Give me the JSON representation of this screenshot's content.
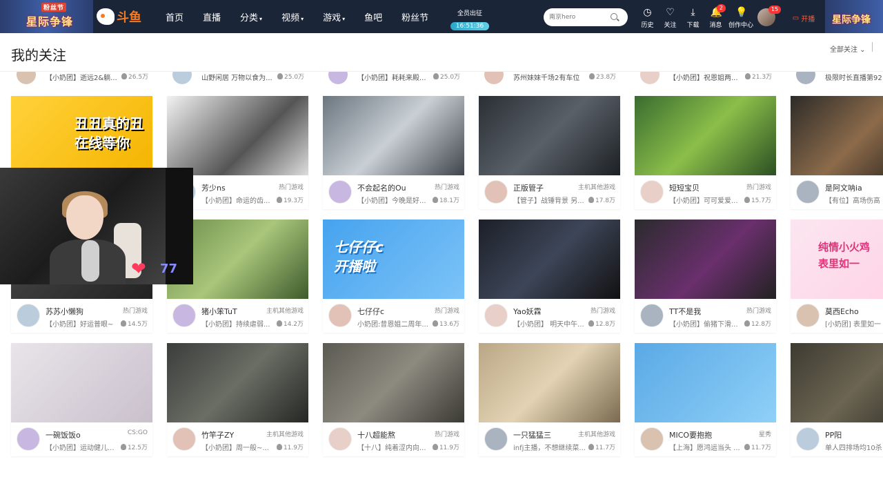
{
  "nav": {
    "banner_left": "星际争锋",
    "banner_left_small": "粉丝节",
    "logo_text": "斗鱼",
    "items": [
      {
        "label": "首页",
        "caret": ""
      },
      {
        "label": "直播",
        "caret": ""
      },
      {
        "label": "分类",
        "caret": "▾"
      },
      {
        "label": "视频",
        "caret": "▾"
      },
      {
        "label": "游戏",
        "caret": "▾"
      },
      {
        "label": "鱼吧",
        "caret": ""
      },
      {
        "label": "粉丝节",
        "caret": ""
      }
    ],
    "event_title": "全员出征",
    "event_timer": "16:51:36",
    "search_placeholder": "南京hero",
    "tools": [
      {
        "label": "历史",
        "icon": "◷",
        "badge": ""
      },
      {
        "label": "关注",
        "icon": "♡",
        "badge": ""
      },
      {
        "label": "下载",
        "icon": "⤓",
        "badge": ""
      },
      {
        "label": "消息",
        "icon": "🔔",
        "badge": "2"
      },
      {
        "label": "创作中心",
        "icon": "💡",
        "badge": ""
      }
    ],
    "avatar_badge": "15",
    "live_button": "开播",
    "banner_right": "星际争锋"
  },
  "page": {
    "title": "我的关注",
    "filter_label": "全部关注 ⌄"
  },
  "partial_row": [
    {
      "desc": "【小奶团】逝远2&躺...",
      "hot": "26.5万"
    },
    {
      "desc": "山野闲居 万物以食为...",
      "hot": "25.0万"
    },
    {
      "desc": "【小奶团】耗耗来殿...",
      "hot": "25.0万"
    },
    {
      "desc": "苏州妹妹千场2有车位",
      "hot": "23.8万"
    },
    {
      "desc": "【小奶团】祝恩姐两...",
      "hot": "21.3万"
    },
    {
      "desc": "极限时长直播第92"
    }
  ],
  "cards": [
    {
      "name": "",
      "category": "",
      "desc": "",
      "hot": "",
      "overlay": "丑丑真的丑\n在线等你"
    },
    {
      "name": "芳少ns",
      "category": "热门游戏",
      "desc": "【小奶团】命运的齿...",
      "hot": "19.3万",
      "overlay": ""
    },
    {
      "name": "不会起名的Ou",
      "category": "热门游戏",
      "desc": "【小奶团】今晚是好...",
      "hot": "18.1万",
      "overlay": ""
    },
    {
      "name": "正版管子",
      "category": "主机其他游戏",
      "desc": "【管子】战锤背景 另...",
      "hot": "17.8万",
      "overlay": ""
    },
    {
      "name": "短短宝贝",
      "category": "热门游戏",
      "desc": "【小奶团】可可爱爱...",
      "hot": "15.7万",
      "overlay": ""
    },
    {
      "name": "是阿文呐ia",
      "category": "",
      "desc": "【有位】高场伤高",
      "hot": "",
      "overlay": ""
    },
    {
      "name": "苏苏小懒狗",
      "category": "热门游戏",
      "desc": "【小奶团】好运普眼~",
      "hot": "14.5万",
      "overlay": ""
    },
    {
      "name": "猪小笨TuT",
      "category": "主机其他游戏",
      "desc": "【小奶团】持续虐弱...",
      "hot": "14.2万",
      "overlay": ""
    },
    {
      "name": "七仔仔c",
      "category": "热门游戏",
      "desc": "小奶团:昔恩姐二周年...",
      "hot": "13.6万",
      "overlay": "七仔仔c\n开播啦"
    },
    {
      "name": "Yao妖霖",
      "category": "热门游戏",
      "desc": "【小奶团】 明天中午...",
      "hot": "12.8万",
      "overlay": ""
    },
    {
      "name": "TT不是我",
      "category": "热门游戏",
      "desc": "【小奶团】偷猪下滑...",
      "hot": "12.8万",
      "overlay": ""
    },
    {
      "name": "莫西Echo",
      "category": "",
      "desc": "[小奶团] 表里如一",
      "hot": "",
      "overlay": "纯情小火鸡\n表里如一"
    },
    {
      "name": "一碗饭饭o",
      "category": "CS:GO",
      "desc": "【小奶团】运动健儿...",
      "hot": "12.5万",
      "overlay": ""
    },
    {
      "name": "竹竿子ZY",
      "category": "主机其他游戏",
      "desc": "【小奶团】周一般~...",
      "hot": "11.9万",
      "overlay": ""
    },
    {
      "name": "十八超能熬",
      "category": "热门游戏",
      "desc": "【十八】纯着涩内向...",
      "hot": "11.9万",
      "overlay": ""
    },
    {
      "name": "一只猛猛三",
      "category": "主机其他游戏",
      "desc": "infj主播，不想继续菜...",
      "hot": "11.7万",
      "overlay": ""
    },
    {
      "name": "MICO要抱抱",
      "category": "星秀",
      "desc": "【上海】愿鸿运当头 ...",
      "hot": "11.7万",
      "overlay": ""
    },
    {
      "name": "PP阳",
      "category": "",
      "desc": "单人四排场均10杀",
      "hot": "",
      "overlay": ""
    }
  ],
  "cam": {
    "count": "77"
  }
}
